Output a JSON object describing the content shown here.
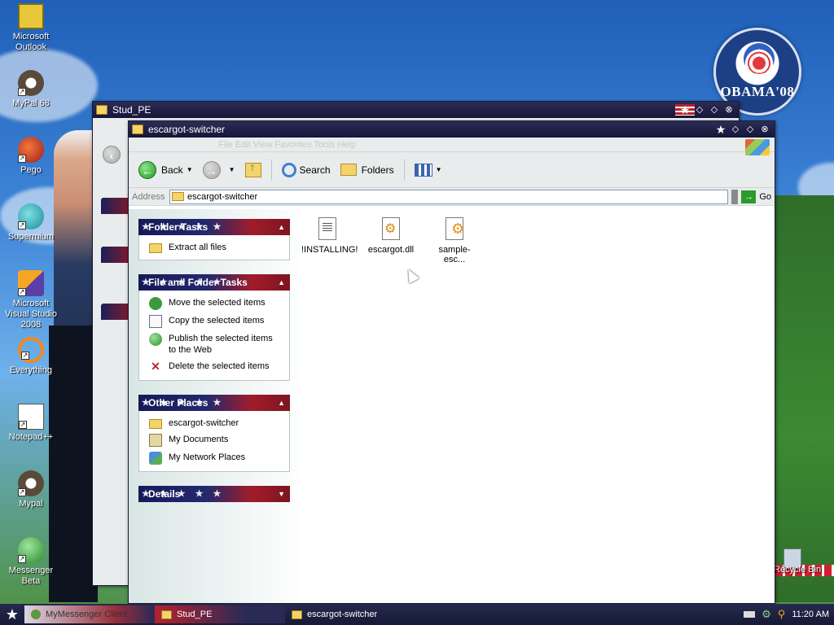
{
  "desktop": {
    "icons": [
      {
        "label": "Microsoft Outlook",
        "icon": "outlook-icon"
      },
      {
        "label": "MyPal 68",
        "icon": "raccoon-icon"
      },
      {
        "label": "Pego",
        "icon": "pego-icon"
      },
      {
        "label": "Supermium",
        "icon": "supermium-icon"
      },
      {
        "label": "Microsoft Visual Studio 2008",
        "icon": "visual-studio-icon"
      },
      {
        "label": "Everything",
        "icon": "everything-icon"
      },
      {
        "label": "Notepad++",
        "icon": "notepad-icon"
      },
      {
        "label": "Mypal",
        "icon": "raccoon-icon"
      },
      {
        "label": "Messenger Beta",
        "icon": "messenger-icon"
      }
    ],
    "recycle_bin_label": "Recycle Bin",
    "badge_text": "OBAMA'08"
  },
  "stud_window": {
    "title": "Stud_PE"
  },
  "main_window": {
    "title": "escargot-switcher",
    "menu_ghost": "File Edit View Favorites Tools Help",
    "toolbar": {
      "back_label": "Back",
      "search_label": "Search",
      "folders_label": "Folders"
    },
    "address": {
      "label": "Address",
      "value": "escargot-switcher",
      "go_label": "Go"
    },
    "panels": {
      "folder_tasks": {
        "title": "Folder Tasks",
        "items": [
          "Extract all files"
        ]
      },
      "file_tasks": {
        "title": "File and Folder Tasks",
        "items": [
          "Move the selected items",
          "Copy the selected items",
          "Publish the selected items to the Web",
          "Delete the selected items"
        ]
      },
      "other_places": {
        "title": "Other Places",
        "items": [
          "escargot-switcher",
          "My Documents",
          "My Network Places"
        ]
      },
      "details": {
        "title": "Details"
      }
    },
    "files": [
      {
        "name": "!INSTALLING!",
        "type": "txt"
      },
      {
        "name": "escargot.dll",
        "type": "dll"
      },
      {
        "name": "sample-esc...",
        "type": "cfg"
      }
    ]
  },
  "taskbar": {
    "items": [
      "MyMessenger Client",
      "Stud_PE",
      "escargot-switcher"
    ],
    "clock": "11:20 AM"
  }
}
